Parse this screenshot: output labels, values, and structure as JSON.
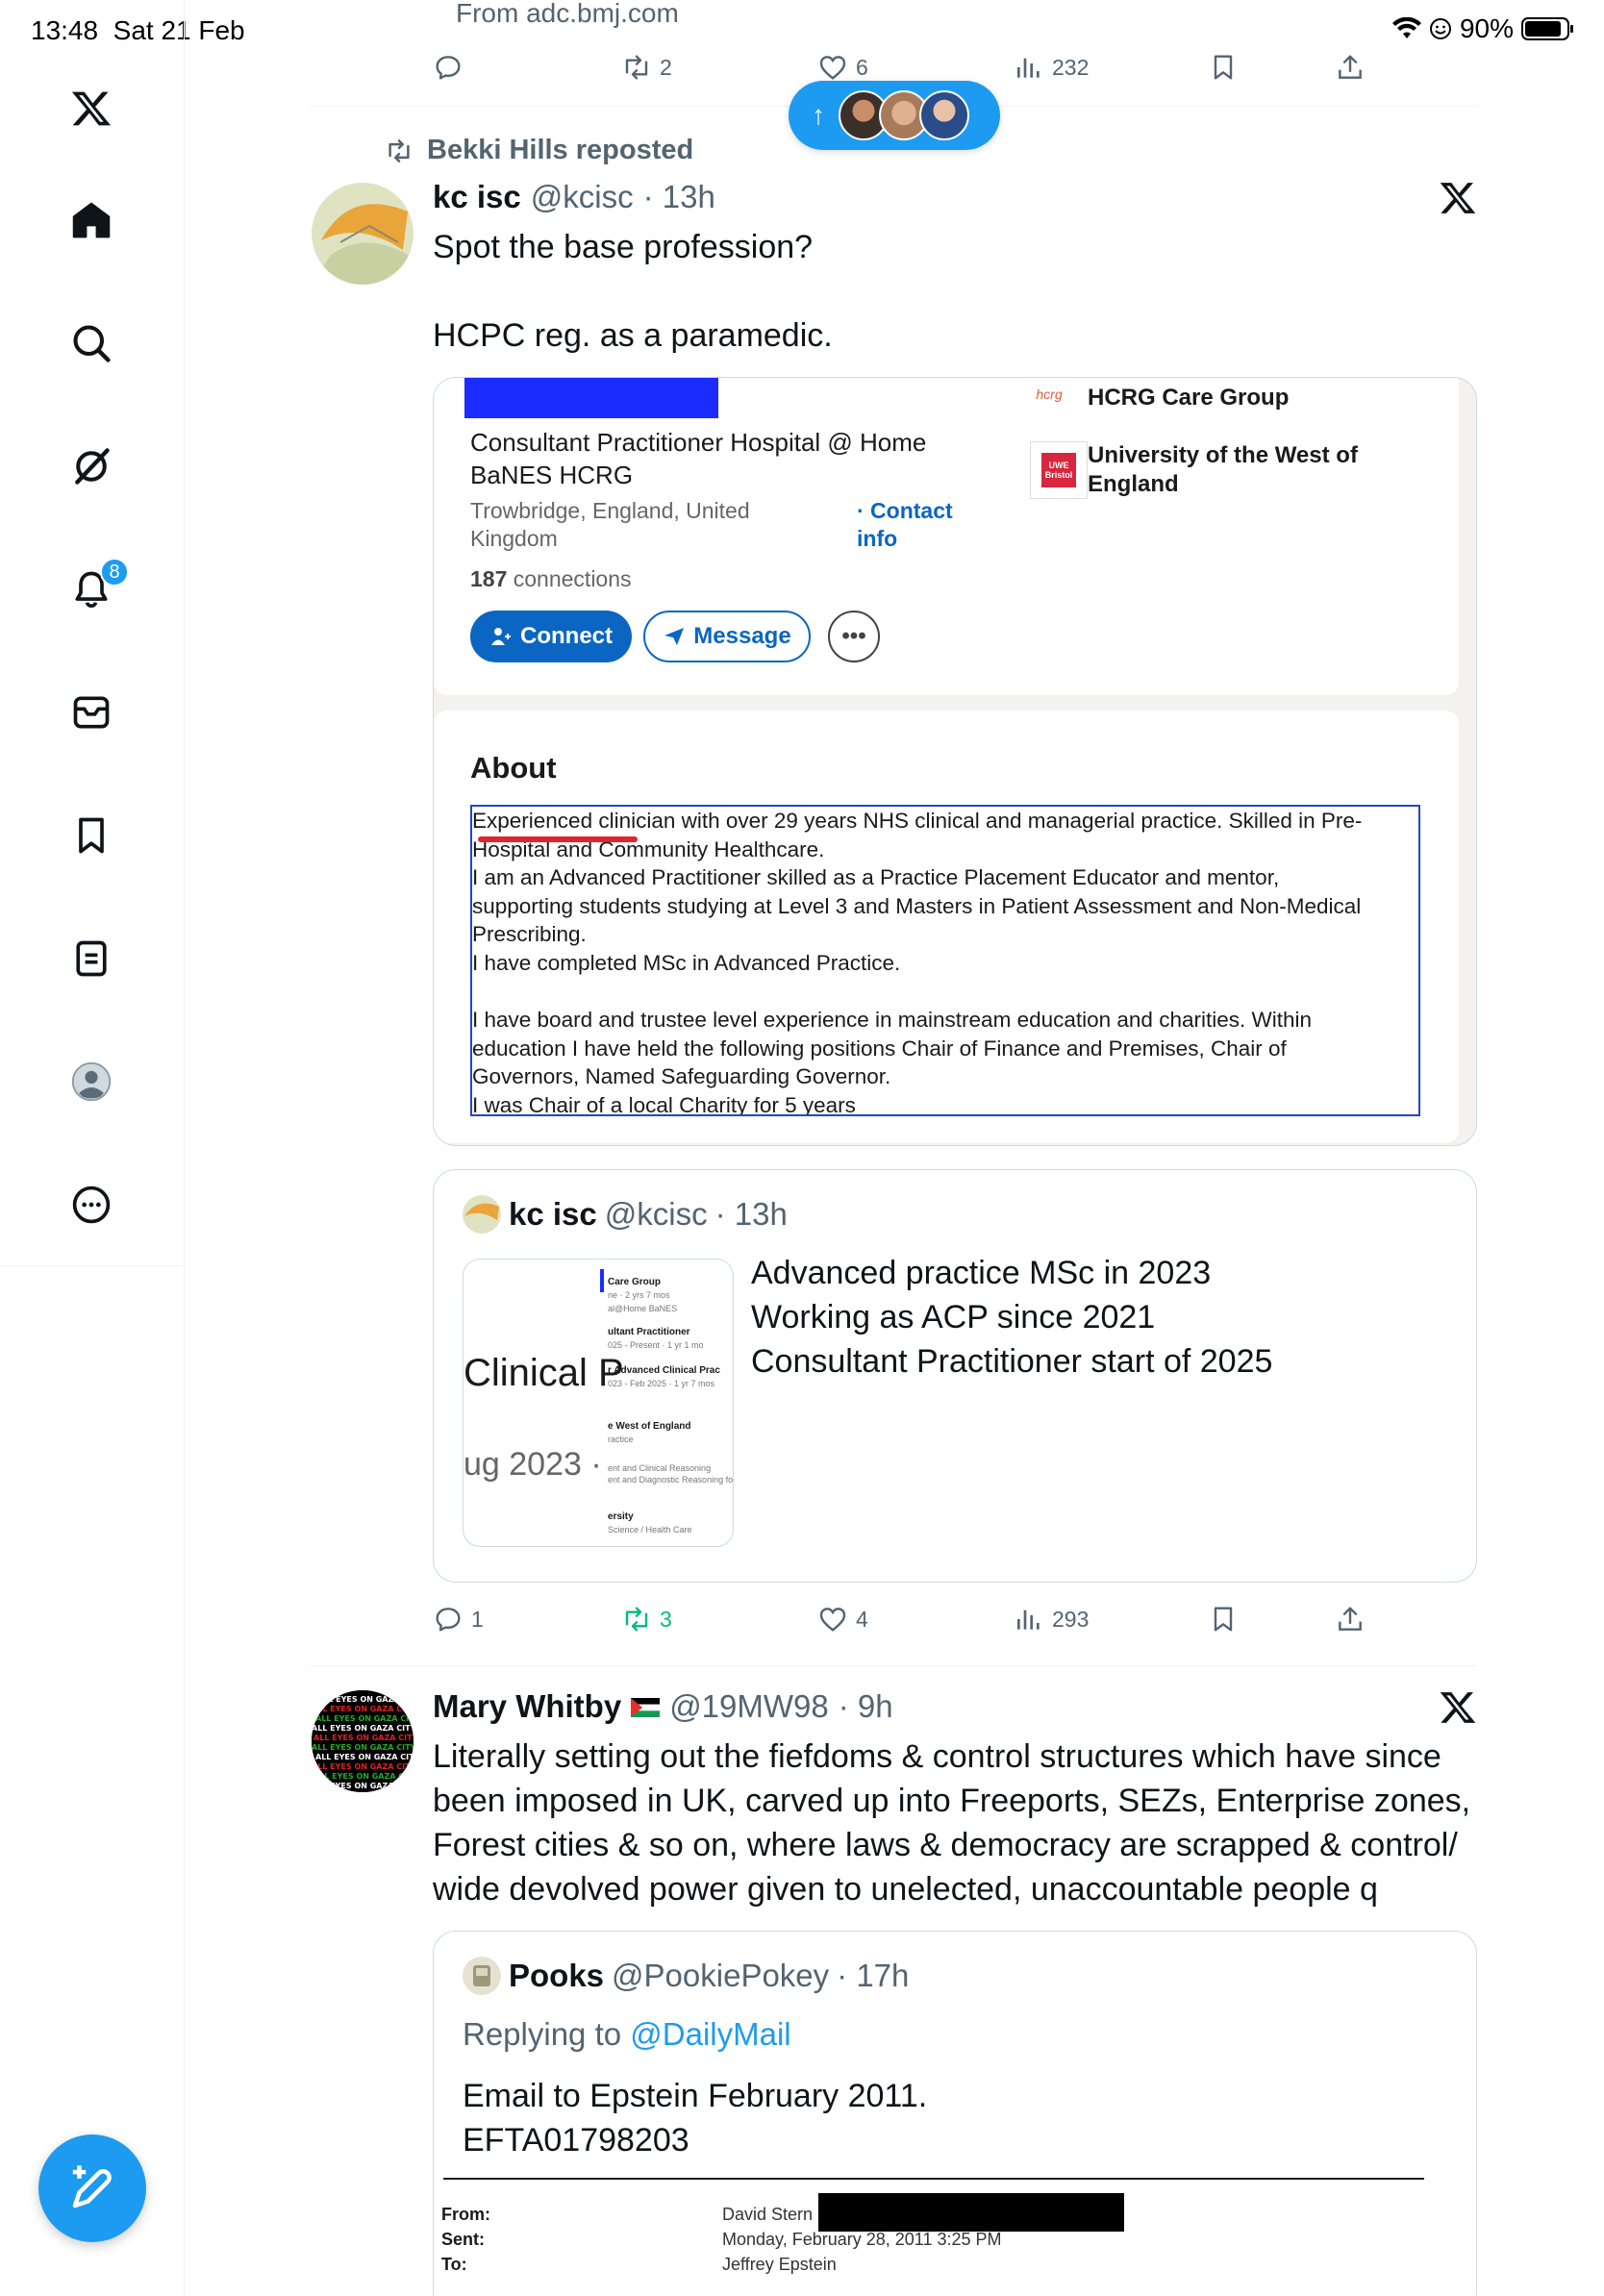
{
  "status_bar": {
    "time": "13:48",
    "date": "Sat 21 Feb",
    "battery": "90%"
  },
  "nav": {
    "notifications_count": "8"
  },
  "top_tweet": {
    "link_domain": "From adc.bmj.com",
    "replies": "",
    "reposts": "2",
    "likes": "6",
    "views": "232"
  },
  "repost": {
    "reposter_line": "Bekki Hills reposted",
    "author_name": "kc isc",
    "author_handle": "@kcisc",
    "time": "· 13h",
    "text": "Spot the base profession?\n\nHCPC reg. as a paramedic.",
    "profile_image": {
      "headline": "Consultant Practitioner Hospital @ Home BaNES HCRG",
      "location": "Trowbridge, England, United Kingdom",
      "contact": "· Contact info",
      "connections_count": "187",
      "connections_label": " connections",
      "connect_label": "Connect",
      "message_label": "Message",
      "org1_logo": "hcrg",
      "org1": "HCRG Care Group",
      "org2_logo": "UWE Bristol",
      "org2": "University of the West of England",
      "about_title": "About",
      "about_text": "Experienced clinician with over 29 years NHS clinical and managerial practice. Skilled in Pre-\nHospital and Community Healthcare.\nI am an Advanced Practitioner skilled as a Practice Placement Educator and mentor,\nsupporting students studying at Level 3 and Masters in Patient Assessment and Non-Medical\nPrescribing.\nI have completed MSc in Advanced Practice.\n\nI have board and trustee level experience in mainstream education and charities. Within\neducation I have held the following positions Chair of Finance and Premises, Chair of\nGovernors, Named Safeguarding Governor.\nI was Chair of a local Charity for 5 years"
    },
    "quote": {
      "author_name": "kc isc",
      "author_handle": "@kcisc",
      "time": "· 13h",
      "text": "Advanced practice MSc in 2023\nWorking as ACP since 2021\nConsultant Practitioner start of 2025",
      "thumb": {
        "big1": "Clinical P",
        "big2": "ug 2023 ·",
        "l1": "Care Group",
        "l2": "ne · 2 yrs 7 mos",
        "l3": "al@Home BaNES",
        "l4": "ultant Practitioner",
        "l5": "025 - Present · 1 yr 1 mo",
        "l6": "r Advanced Clinical Prac",
        "l7": "023 - Feb 2025 · 1 yr 7 mos",
        "l8": "e West of England",
        "l9": "ractice",
        "l10": "ent and Clinical Reasoning",
        "l11": "ent and Diagnostic Reasoning for A",
        "l12": "ersity",
        "l13": "Science / Health Care"
      }
    },
    "replies": "1",
    "reposts": "3",
    "likes": "4",
    "views": "293"
  },
  "post2": {
    "author_name": "Mary Whitby",
    "author_handle": "@19MW98",
    "time": "· 9h",
    "avatar_text": "ALL EYES ON GAZA CITY",
    "text": "Literally setting out the fiefdoms & control structures which have since\nbeen imposed in UK, carved up into Freeports, SEZs, Enterprise zones,\nForest cities & so on, where laws & democracy are scrapped & control/\nwide devolved power given to unelected, unaccountable people q",
    "quote": {
      "author_name": "Pooks",
      "author_handle": "@PookiePokey",
      "time": "· 17h",
      "replying_prefix": "Replying to ",
      "replying_to": "@DailyMail",
      "text": "Email to Epstein February 2011.\nEFTA01798203",
      "email": {
        "from_label": "From:",
        "sent_label": "Sent:",
        "to_label": "To:",
        "from": "David Stern",
        "sent": "Monday, February 28, 2011 3:25 PM",
        "to": "Jeffrey Epstein"
      }
    }
  },
  "colors": {
    "accent": "#1d9bf0",
    "repost_green": "#00ba7c",
    "linkedin_blue": "#0a66c2"
  }
}
